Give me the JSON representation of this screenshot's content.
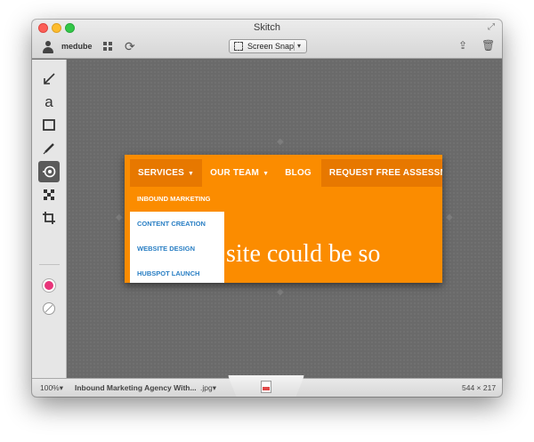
{
  "window": {
    "title": "Skitch"
  },
  "toolbar": {
    "username": "medube",
    "snap_label": "Screen Snap",
    "snap_dropdown": "▾"
  },
  "palette": {
    "tools": [
      "arrow",
      "text",
      "rectangle",
      "pen",
      "highlighter",
      "pixelate",
      "crop"
    ],
    "text_tool_glyph": "a",
    "active_tool": "highlighter",
    "colors": {
      "primary": "#e8347a",
      "secondary": "#ffffff"
    }
  },
  "snapshot": {
    "nav": {
      "services": "SERVICES",
      "our_team": "OUR TEAM",
      "blog": "BLOG",
      "cta": "REQUEST FREE ASSESSMENT"
    },
    "dropdown": [
      "INBOUND MARKETING",
      "CONTENT CREATION",
      "WEBSITE DESIGN",
      "HUBSPOT LAUNCH"
    ],
    "hero_text": "site could be so",
    "accent_color": "#fb8c00"
  },
  "statusbar": {
    "zoom": "100%▾",
    "filename": "Inbound Marketing Agency With...",
    "format": ".jpg▾",
    "dimensions": "544 × 217"
  }
}
